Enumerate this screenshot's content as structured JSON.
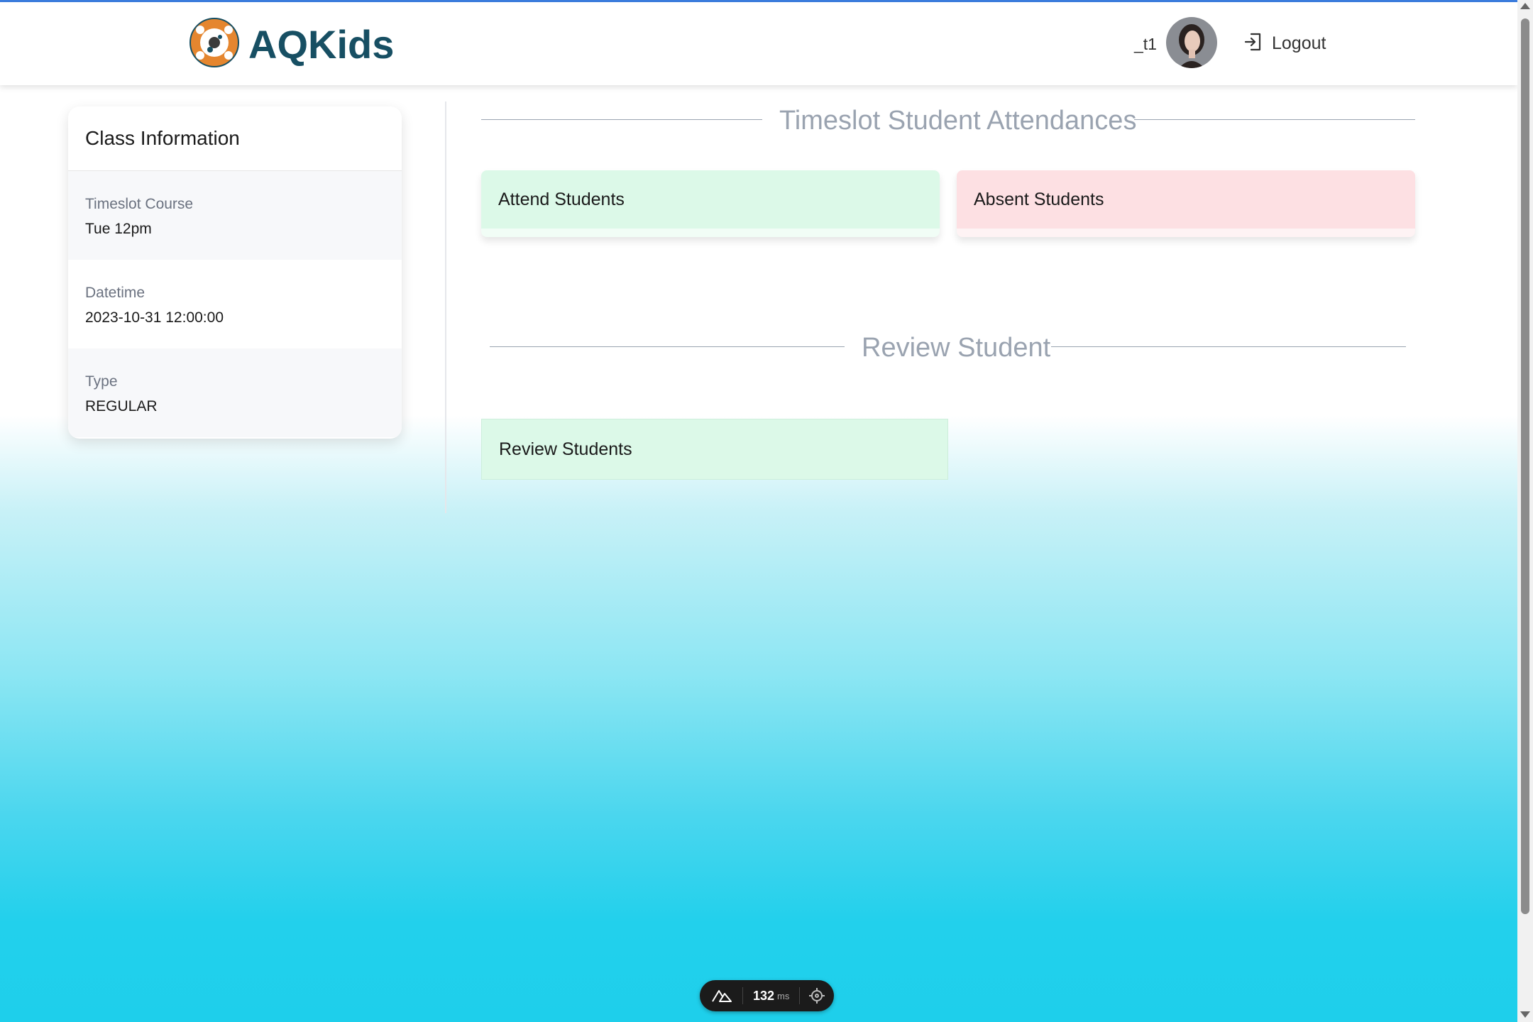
{
  "header": {
    "brand": "AQKids",
    "logo_icon": "aqkids-logo-icon",
    "username": "_t1",
    "avatar_icon": "user-avatar",
    "logout_label": "Logout",
    "logout_icon": "logout-icon"
  },
  "class_info": {
    "title": "Class Information",
    "rows": [
      {
        "label": "Timeslot Course",
        "value": "Tue 12pm"
      },
      {
        "label": "Datetime",
        "value": "2023-10-31 12:00:00"
      },
      {
        "label": "Type",
        "value": "REGULAR"
      }
    ]
  },
  "attendance": {
    "title": "Timeslot Student Attendances",
    "attend_label": "Attend Students",
    "absent_label": "Absent Students"
  },
  "review": {
    "title": "Review Student",
    "button_label": "Review Students"
  },
  "devtools": {
    "icon": "nuxt-icon",
    "ms_value": "132",
    "ms_unit": "ms",
    "target_icon": "crosshair-icon"
  },
  "colors": {
    "brand": "#174f63",
    "topline": "#3b7de0",
    "attend_bg": "#dcf9e8",
    "absent_bg": "#fde0e3",
    "section_title": "#9aa3b0"
  }
}
